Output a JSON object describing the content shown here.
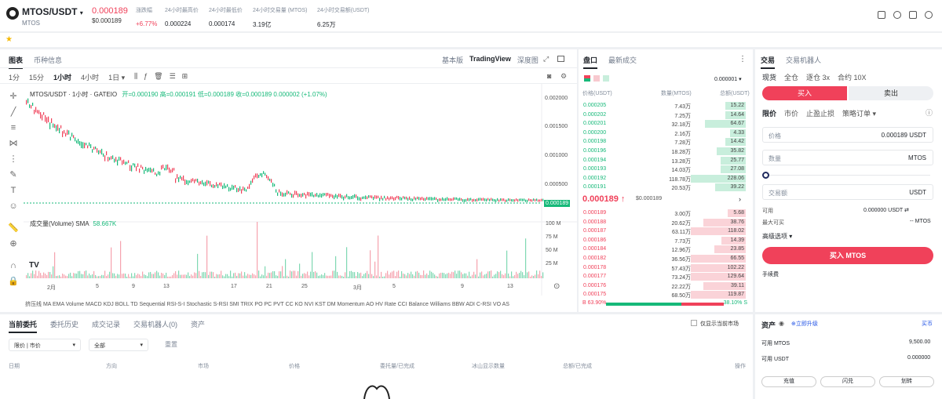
{
  "header": {
    "pair": "MTOS/USDT",
    "base": "MTOS",
    "price": "0.000189",
    "price_usd": "$0.000189",
    "stats": [
      {
        "label": "涨跌幅",
        "value": "+6.77%"
      },
      {
        "label": "24小时最高价",
        "value": "0.000224"
      },
      {
        "label": "24小时最低价",
        "value": "0.000174"
      },
      {
        "label": "24小时交易量 (MTOS)",
        "value": "3.19亿"
      },
      {
        "label": "24小时交易额(USDT)",
        "value": "6.25万"
      }
    ]
  },
  "chart_panel": {
    "tabs": [
      "图表",
      "币种信息"
    ],
    "views": [
      "基本版",
      "TradingView",
      "深度图"
    ],
    "intervals": [
      "1分",
      "15分",
      "1小时",
      "4小时",
      "1日 ▾"
    ],
    "ohlc_title": "MTOS/USDT · 1小时 · GATEIO",
    "ohlc": "开=0.000190 高=0.000191 低=0.000189 收=0.000189 0.000002 (+1.07%)",
    "price_axis": [
      "0.002000",
      "0.001500",
      "0.001000",
      "0.000500"
    ],
    "last_price_tag": "0.000189",
    "volume_label": "成交量(Volume) SMA",
    "volume_value": "58.667K",
    "volume_axis": [
      "100 M",
      "75 M",
      "50 M",
      "25 M"
    ],
    "date_axis": [
      "2月",
      "5",
      "9",
      "13",
      "17",
      "21",
      "25",
      "3月",
      "5",
      "9",
      "13"
    ],
    "indicators": "挤压线 MA EMA Volume MACD KDJ BOLL TD Sequential RSI-S-I Stochastic S-RSI SMI TRIX PO PC PVT CC KO NVI KST DM Momentum AO HV Rate CCI Balance Williams BBW ADI C-RSI VO AS"
  },
  "orderbook": {
    "tabs": [
      "盘口",
      "最新成交"
    ],
    "precision": "0.000001 ▾",
    "headers": [
      "价格(USDT)",
      "数量(MTOS)",
      "总额(USDT)"
    ],
    "bids_top": [
      [
        "0.000205",
        "7.43万",
        "15.22"
      ],
      [
        "0.000202",
        "7.25万",
        "14.64"
      ],
      [
        "0.000201",
        "32.18万",
        "64.67"
      ],
      [
        "0.000200",
        "2.16万",
        "4.33"
      ],
      [
        "0.000198",
        "7.28万",
        "14.42"
      ],
      [
        "0.000196",
        "18.28万",
        "35.82"
      ],
      [
        "0.000194",
        "13.28万",
        "25.77"
      ],
      [
        "0.000193",
        "14.03万",
        "27.08"
      ],
      [
        "0.000192",
        "118.78万",
        "228.06"
      ],
      [
        "0.000191",
        "20.53万",
        "39.22"
      ]
    ],
    "mid_price": "0.000189 ↑",
    "mid_usd": "$0.000189",
    "asks_bottom": [
      [
        "0.000189",
        "3.00万",
        "5.68"
      ],
      [
        "0.000188",
        "20.62万",
        "38.76"
      ],
      [
        "0.000187",
        "63.11万",
        "118.02"
      ],
      [
        "0.000186",
        "7.73万",
        "14.39"
      ],
      [
        "0.000184",
        "12.96万",
        "23.85"
      ],
      [
        "0.000182",
        "36.56万",
        "66.55"
      ],
      [
        "0.000178",
        "57.43万",
        "102.22"
      ],
      [
        "0.000177",
        "73.24万",
        "129.64"
      ],
      [
        "0.000176",
        "22.22万",
        "39.11"
      ],
      [
        "0.000175",
        "68.50万",
        "119.87"
      ]
    ],
    "ratio_buy": "B 63.90%",
    "ratio_sell": "38.10% S",
    "ratio_buy_frac": 0.639
  },
  "trade": {
    "tabs": [
      "交易",
      "交易机器人"
    ],
    "modes": [
      "现货",
      "全仓",
      "逐仓 3x",
      "合约 10X"
    ],
    "buy": "买入",
    "sell": "卖出",
    "order_types": [
      "限价",
      "市价",
      "止盈止损",
      "策略订单 ▾"
    ],
    "price_label": "价格",
    "price_value": "0.000189 USDT",
    "qty_label": "数量",
    "qty_unit": "MTOS",
    "amount_label": "交易额",
    "amount_unit": "USDT",
    "avail_label": "可用",
    "avail_value": "0.000000 USDT ⇄",
    "max_label": "最大可买",
    "max_value": "-- MTOS",
    "advanced": "高级选项 ▾",
    "buy_button": "买入 MTOS",
    "fee": "手续费"
  },
  "orders": {
    "tabs": [
      "当前委托",
      "委托历史",
      "成交记录",
      "交易机器人(0)",
      "资产"
    ],
    "only_current": "仅显示当前市场",
    "filters": [
      "限价 | 市价",
      "全部"
    ],
    "reset": "重置",
    "columns": [
      "日期",
      "方向",
      "市场",
      "价格",
      "委托量/已完成",
      "冰山显示数量",
      "总额/已完成",
      "操作"
    ]
  },
  "assets": {
    "title": "资产",
    "upgrade": "⊕立即升级",
    "more": "买币",
    "rows": [
      [
        "可用 MTOS",
        "9,500.00"
      ],
      [
        "可用 USDT",
        "0.000000"
      ]
    ],
    "buttons": [
      "充值",
      "闪兑",
      "划转"
    ]
  }
}
